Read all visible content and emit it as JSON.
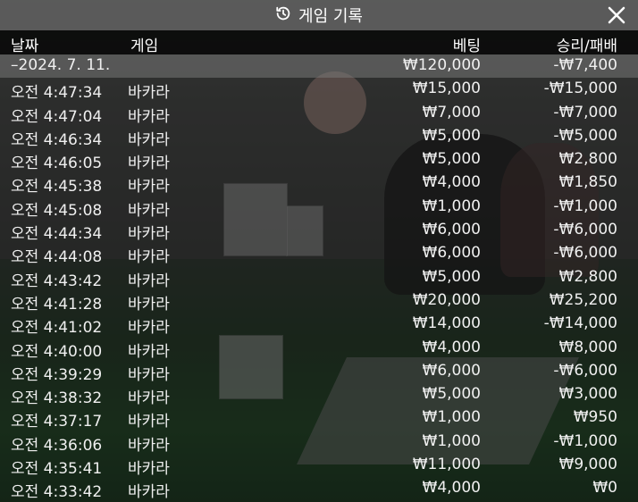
{
  "dialog": {
    "title": "게임 기록",
    "close_icon": "close-icon",
    "history_icon": "history-icon"
  },
  "columns": {
    "date": "날짜",
    "game": "게임",
    "bet": "베팅",
    "result": "승리/패배"
  },
  "day_summary": {
    "date": "–2024. 7. 11.",
    "bet": "₩120,000",
    "result": "-₩7,400"
  },
  "rows": [
    {
      "time": "오전 4:47:34",
      "game": "바카라",
      "bet": "₩15,000",
      "result": "-₩15,000"
    },
    {
      "time": "오전 4:47:04",
      "game": "바카라",
      "bet": "₩7,000",
      "result": "-₩7,000"
    },
    {
      "time": "오전 4:46:34",
      "game": "바카라",
      "bet": "₩5,000",
      "result": "-₩5,000"
    },
    {
      "time": "오전 4:46:05",
      "game": "바카라",
      "bet": "₩5,000",
      "result": "₩2,800"
    },
    {
      "time": "오전 4:45:38",
      "game": "바카라",
      "bet": "₩4,000",
      "result": "₩1,850"
    },
    {
      "time": "오전 4:45:08",
      "game": "바카라",
      "bet": "₩1,000",
      "result": "-₩1,000"
    },
    {
      "time": "오전 4:44:34",
      "game": "바카라",
      "bet": "₩6,000",
      "result": "-₩6,000"
    },
    {
      "time": "오전 4:44:08",
      "game": "바카라",
      "bet": "₩6,000",
      "result": "-₩6,000"
    },
    {
      "time": "오전 4:43:42",
      "game": "바카라",
      "bet": "₩5,000",
      "result": "₩2,800"
    },
    {
      "time": "오전 4:41:28",
      "game": "바카라",
      "bet": "₩20,000",
      "result": "₩25,200"
    },
    {
      "time": "오전 4:41:02",
      "game": "바카라",
      "bet": "₩14,000",
      "result": "-₩14,000"
    },
    {
      "time": "오전 4:40:00",
      "game": "바카라",
      "bet": "₩4,000",
      "result": "₩8,000"
    },
    {
      "time": "오전 4:39:29",
      "game": "바카라",
      "bet": "₩6,000",
      "result": "-₩6,000"
    },
    {
      "time": "오전 4:38:32",
      "game": "바카라",
      "bet": "₩5,000",
      "result": "₩3,000"
    },
    {
      "time": "오전 4:37:17",
      "game": "바카라",
      "bet": "₩1,000",
      "result": "₩950"
    },
    {
      "time": "오전 4:36:06",
      "game": "바카라",
      "bet": "₩1,000",
      "result": "-₩1,000"
    },
    {
      "time": "오전 4:35:41",
      "game": "바카라",
      "bet": "₩11,000",
      "result": "₩9,000"
    },
    {
      "time": "오전 4:33:42",
      "game": "바카라",
      "bet": "₩4,000",
      "result": "₩0"
    }
  ]
}
